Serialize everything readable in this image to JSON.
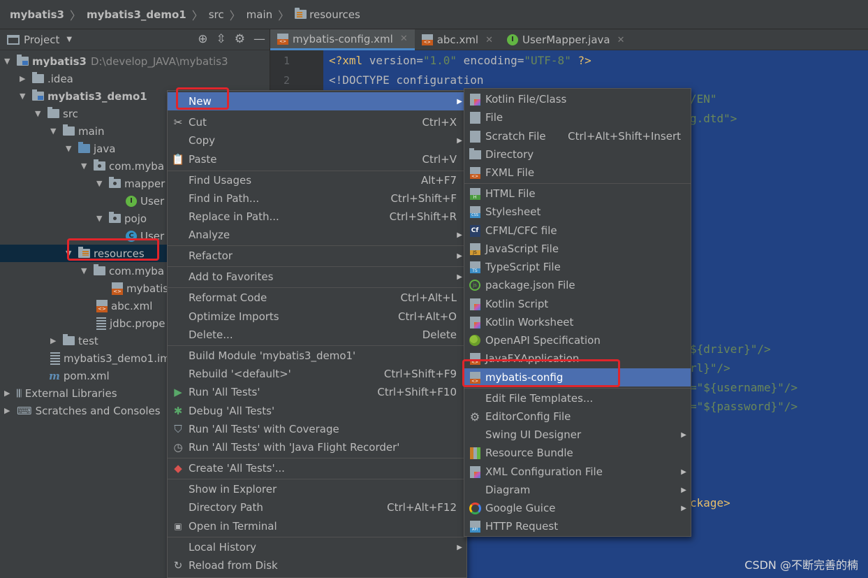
{
  "breadcrumb": [
    "mybatis3",
    "mybatis3_demo1",
    "src",
    "main",
    "resources"
  ],
  "project_panel": {
    "title": "Project",
    "tree": [
      {
        "label": "mybatis3",
        "extra": "D:\\develop_JAVA\\mybatis3"
      },
      {
        "label": ".idea"
      },
      {
        "label": "mybatis3_demo1"
      },
      {
        "label": "src"
      },
      {
        "label": "main"
      },
      {
        "label": "java"
      },
      {
        "label": "com.myba"
      },
      {
        "label": "mapper"
      },
      {
        "label": "User"
      },
      {
        "label": "pojo"
      },
      {
        "label": "User"
      },
      {
        "label": "resources"
      },
      {
        "label": "com.myba"
      },
      {
        "label": "mybatis"
      },
      {
        "label": "abc.xml"
      },
      {
        "label": "jdbc.prope"
      },
      {
        "label": "test"
      },
      {
        "label": "mybatis3_demo1.im"
      },
      {
        "label": "pom.xml"
      },
      {
        "label": "External Libraries"
      },
      {
        "label": "Scratches and Consoles"
      }
    ]
  },
  "editor": {
    "tabs": [
      {
        "label": "mybatis-config.xml",
        "icon": "xml-file-icon"
      },
      {
        "label": "abc.xml",
        "icon": "xml-file-icon"
      },
      {
        "label": "UserMapper.java",
        "icon": "interface-icon"
      }
    ],
    "line_numbers": [
      "1",
      "2"
    ],
    "lines": [
      {
        "tag1": "<?xml ",
        "attr1": "version",
        "eq1": "=",
        "val1": "\"1.0\"",
        "attr2": " encoding",
        "eq2": "=",
        "val2": "\"UTF-8\"",
        "tail": " ?>"
      },
      {
        "text": "<!DOCTYPE configuration"
      }
    ],
    "fragments": [
      "/EN\"",
      "g.dtd\">",
      "${driver}\"/>",
      "rl}\"/>",
      "=\"${username}\"/>",
      "=\"${password}\"/>",
      "ckage>"
    ]
  },
  "context_menu": [
    {
      "label": "New",
      "submenu": true,
      "highlighted": true
    },
    {
      "label": "Cut",
      "shortcut": "Ctrl+X",
      "icon": "scissors-icon"
    },
    {
      "label": "Copy",
      "submenu": true
    },
    {
      "label": "Paste",
      "shortcut": "Ctrl+V",
      "icon": "clipboard-icon"
    },
    {
      "label": "Find Usages",
      "shortcut": "Alt+F7"
    },
    {
      "label": "Find in Path...",
      "shortcut": "Ctrl+Shift+F"
    },
    {
      "label": "Replace in Path...",
      "shortcut": "Ctrl+Shift+R"
    },
    {
      "label": "Analyze",
      "submenu": true
    },
    {
      "label": "Refactor",
      "submenu": true
    },
    {
      "label": "Add to Favorites",
      "submenu": true
    },
    {
      "label": "Reformat Code",
      "shortcut": "Ctrl+Alt+L"
    },
    {
      "label": "Optimize Imports",
      "shortcut": "Ctrl+Alt+O"
    },
    {
      "label": "Delete...",
      "shortcut": "Delete"
    },
    {
      "label": "Build Module 'mybatis3_demo1'"
    },
    {
      "label": "Rebuild '<default>'",
      "shortcut": "Ctrl+Shift+F9"
    },
    {
      "label": "Run 'All Tests'",
      "shortcut": "Ctrl+Shift+F10",
      "icon": "run-icon"
    },
    {
      "label": "Debug 'All Tests'",
      "icon": "debug-icon"
    },
    {
      "label": "Run 'All Tests' with Coverage",
      "icon": "coverage-icon"
    },
    {
      "label": "Run 'All Tests' with 'Java Flight Recorder'",
      "icon": "profiler-icon"
    },
    {
      "label": "Create 'All Tests'...",
      "icon": "create-test-icon"
    },
    {
      "label": "Show in Explorer"
    },
    {
      "label": "Directory Path",
      "shortcut": "Ctrl+Alt+F12"
    },
    {
      "label": "Open in Terminal",
      "icon": "terminal-icon"
    },
    {
      "label": "Local History",
      "submenu": true
    },
    {
      "label": "Reload from Disk",
      "icon": "reload-icon"
    }
  ],
  "new_submenu": [
    {
      "label": "Kotlin File/Class",
      "icon": "kotlin-file-icon"
    },
    {
      "label": "File",
      "icon": "file-icon"
    },
    {
      "label": "Scratch File",
      "shortcut": "Ctrl+Alt+Shift+Insert",
      "icon": "scratch-file-icon"
    },
    {
      "label": "Directory",
      "icon": "directory-icon"
    },
    {
      "label": "FXML File",
      "icon": "fxml-file-icon"
    },
    {
      "label": "HTML File",
      "icon": "html-file-icon"
    },
    {
      "label": "Stylesheet",
      "icon": "css-file-icon"
    },
    {
      "label": "CFML/CFC file",
      "icon": "cfml-file-icon"
    },
    {
      "label": "JavaScript File",
      "icon": "js-file-icon"
    },
    {
      "label": "TypeScript File",
      "icon": "ts-file-icon"
    },
    {
      "label": "package.json File",
      "icon": "nodejs-icon"
    },
    {
      "label": "Kotlin Script",
      "icon": "kotlin-script-icon"
    },
    {
      "label": "Kotlin Worksheet",
      "icon": "kotlin-worksheet-icon"
    },
    {
      "label": "OpenAPI Specification",
      "icon": "openapi-icon"
    },
    {
      "label": "JavaFXApplication",
      "icon": "javafx-icon"
    },
    {
      "label": "mybatis-config",
      "icon": "xml-template-icon",
      "highlighted": true
    },
    {
      "label": "Edit File Templates..."
    },
    {
      "label": "EditorConfig File",
      "icon": "gear-icon"
    },
    {
      "label": "Swing UI Designer",
      "submenu": true
    },
    {
      "label": "Resource Bundle",
      "icon": "resource-bundle-icon"
    },
    {
      "label": "XML Configuration File",
      "submenu": true,
      "icon": "xml-config-icon"
    },
    {
      "label": "Diagram",
      "submenu": true
    },
    {
      "label": "Google Guice",
      "submenu": true,
      "icon": "google-icon"
    },
    {
      "label": "HTTP Request",
      "icon": "http-api-icon"
    }
  ],
  "watermark": "CSDN @不断完善的楠",
  "colors": {
    "highlight": "#4b6eaf",
    "annotation": "#e0252b",
    "editor_selection": "#214283"
  }
}
